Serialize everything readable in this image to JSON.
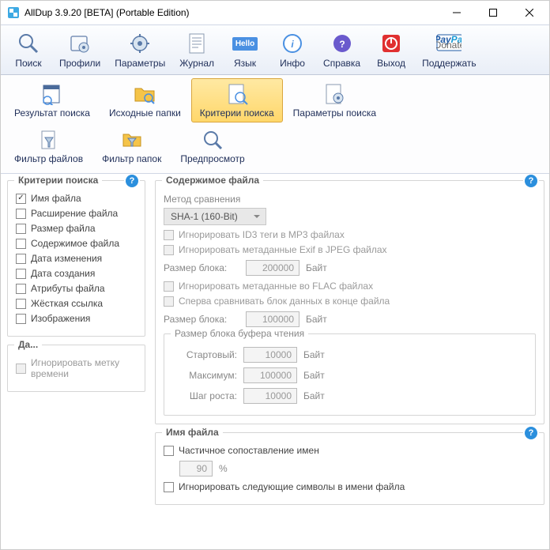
{
  "window": {
    "title": "AllDup 3.9.20 [BETA] (Portable Edition)"
  },
  "toolbar": {
    "search": "Поиск",
    "profiles": "Профили",
    "settings": "Параметры",
    "log": "Журнал",
    "lang": "Язык",
    "lang_badge": "Hello",
    "info": "Инфо",
    "help": "Справка",
    "exit": "Выход",
    "donate": "Поддержать"
  },
  "ribbon": {
    "results": "Результат поиска",
    "source": "Исходные папки",
    "criteria": "Критерии поиска",
    "params": "Параметры поиска",
    "file_filter": "Фильтр файлов",
    "folder_filter": "Фильтр папок",
    "preview": "Предпросмотр"
  },
  "criteria_group": {
    "title": "Критерии поиска",
    "filename": "Имя файла",
    "extension": "Расширение файла",
    "filesize": "Размер файла",
    "content": "Содержимое файла",
    "mod_date": "Дата изменения",
    "create_date": "Дата создания",
    "attrs": "Атрибуты файла",
    "hardlink": "Жёсткая ссылка",
    "images": "Изображения"
  },
  "date_group": {
    "title": "Да...",
    "ignore_ts": "Игнорировать метку времени"
  },
  "content_group": {
    "title": "Содержимое файла",
    "method_label": "Метод сравнения",
    "method_value": "SHA-1 (160-Bit)",
    "ignore_id3": "Игнорировать ID3 теги в MP3 файлах",
    "ignore_exif": "Игнорировать метаданные Exif в JPEG файлах",
    "block_size_label": "Размер блока:",
    "block1_value": "200000",
    "ignore_flac": "Игнорировать метаданные во FLAC файлах",
    "compare_end": "Сперва сравнивать блок данных в конце файла",
    "block2_value": "100000",
    "byte_unit": "Байт",
    "buffer_title": "Размер блока буфера чтения",
    "start_label": "Стартовый:",
    "start_value": "10000",
    "max_label": "Максимум:",
    "max_value": "100000",
    "step_label": "Шаг роста:",
    "step_value": "10000"
  },
  "filename_group": {
    "title": "Имя файла",
    "partial": "Частичное сопоставление имен",
    "percent_value": "90",
    "percent_unit": "%",
    "ignore_chars": "Игнорировать следующие символы в имени файла"
  }
}
